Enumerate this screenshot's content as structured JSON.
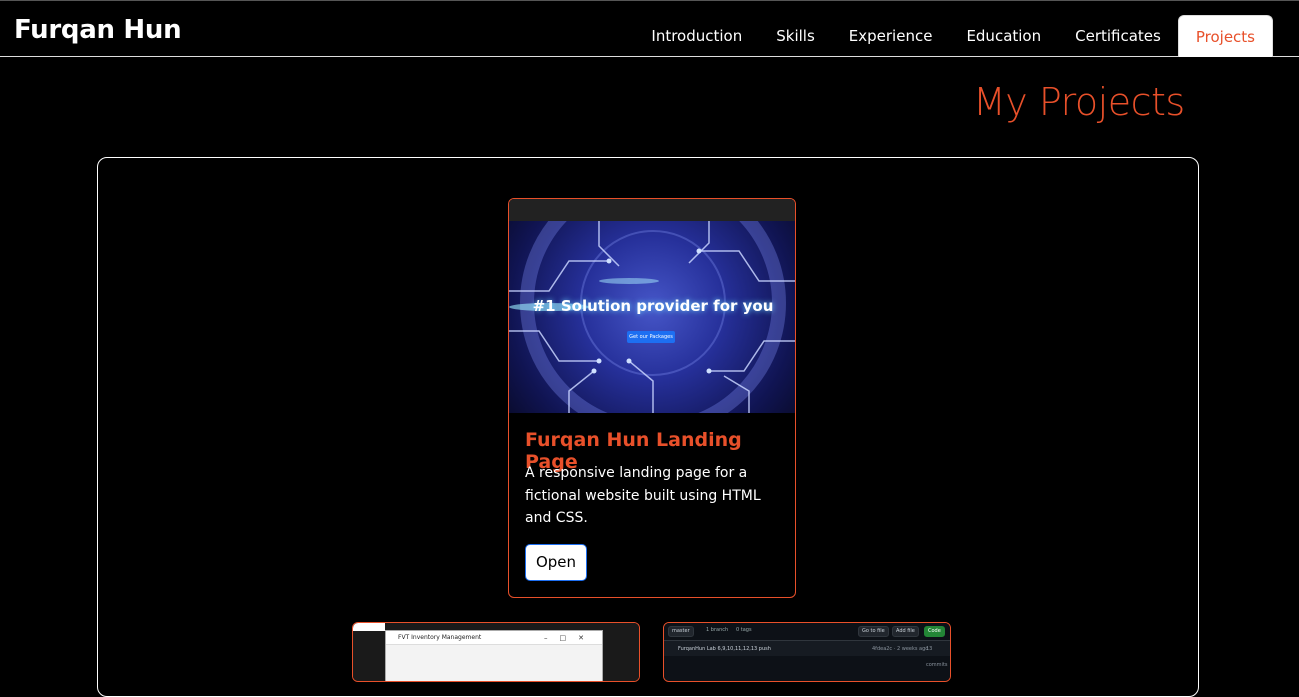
{
  "navbar": {
    "brand": "Furqan Hun",
    "links": [
      {
        "label": "Introduction"
      },
      {
        "label": "Skills"
      },
      {
        "label": "Experience"
      },
      {
        "label": "Education"
      },
      {
        "label": "Certificates"
      },
      {
        "label": "Projects",
        "active": true
      }
    ]
  },
  "page": {
    "title": "My Projects",
    "accent_color": "#e8502a"
  },
  "projects": [
    {
      "thumbnail_text": "#1 Solution provider for you",
      "thumbnail_button": "Get our Packages",
      "title": "Furqan Hun Landing Page",
      "description": "A responsive landing page for a fictional website built using HTML and CSS.",
      "button_label": "Open"
    },
    {
      "thumbnail_window_title": "FVT Inventory Management"
    },
    {
      "thumbnail_branch": "master",
      "thumbnail_branches": "1 branch",
      "thumbnail_tags": "0 tags",
      "thumbnail_goto": "Go to file",
      "thumbnail_add": "Add file",
      "thumbnail_code": "Code",
      "thumbnail_commit": "FurqanHun Lab 6,9,10,11,12,13 push",
      "thumbnail_commit_meta": "4fdea2c · 2 weeks ago",
      "thumbnail_commits": "13 commits"
    }
  ]
}
